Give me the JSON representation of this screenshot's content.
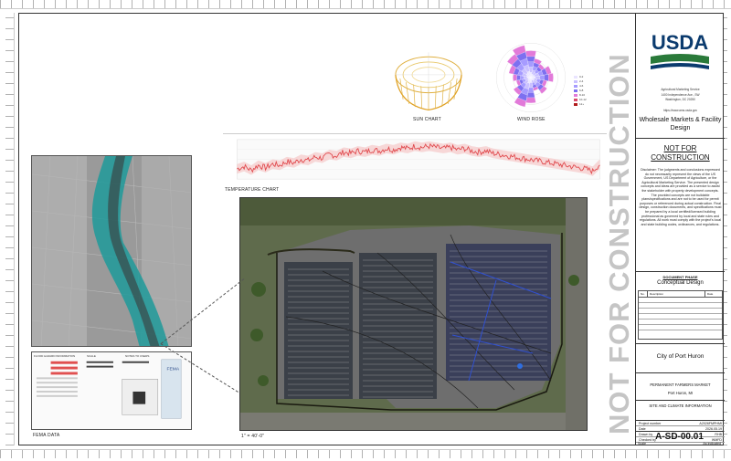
{
  "charts": {
    "sun_chart_label": "SUN CHART",
    "wind_rose_label": "WIND ROSE",
    "temperature_chart_label": "TEMPERATURE CHART",
    "wind_legend": [
      {
        "label": "0-2",
        "color": "#e9e4ff"
      },
      {
        "label": "2-4",
        "color": "#c9c0ff"
      },
      {
        "label": "4-6",
        "color": "#a69bff"
      },
      {
        "label": "6-8",
        "color": "#7d70f0"
      },
      {
        "label": "8-10",
        "color": "#e27ad9"
      },
      {
        "label": "10-12",
        "color": "#d94a6a"
      },
      {
        "label": "12+",
        "color": "#b01a1a"
      }
    ]
  },
  "chart_data": [
    {
      "type": "line",
      "title": "TEMPERATURE CHART",
      "series": [
        {
          "values": [
            12,
            14,
            11,
            15,
            13,
            16,
            15,
            18,
            17,
            20,
            19,
            22,
            21,
            24,
            23,
            26,
            25,
            27,
            26,
            28,
            27,
            29,
            28,
            30,
            29,
            31,
            30,
            31,
            30,
            29,
            30,
            28,
            29,
            27,
            26,
            27,
            25,
            24,
            23,
            22,
            21,
            20,
            19,
            18,
            17,
            16,
            15,
            14,
            13,
            12,
            10,
            16
          ]
        }
      ],
      "colors": {
        "line": "#e0484c",
        "band": "#f3b3b3"
      }
    }
  ],
  "map": {
    "fema_label": "FEMA DATA",
    "legend_headers": [
      "FLOOD HAZARD INFORMATION",
      "SCALE",
      "NOTES TO USERS"
    ],
    "scale_note": "1\" = 40'-0\""
  },
  "title_block": {
    "agency": "Agricultural Marketing Service",
    "address1": "1400 Independence Ave., SW",
    "address2": "Washington, DC 20250",
    "url": "https://www.ams.usda.gov",
    "department": "Wholesale Markets & Facility Design",
    "nfc_heading": "NOT FOR CONSTRUCTION",
    "disclaimer": "Disclaimer: The judgments and conclusions expressed do not necessarily represent the views of the US Government, US Department of Agriculture, or the Agricultural Marketing Service. The presented design concepts and ideas are provided as a service to assist the stakeholder with property development concepts. The provided concepts are not buildable plans/specifications and are not to be used for permit purposes or referenced during actual construction. Final design, construction documents, and specifications must be prepared by a local certified/licensed building professional as governed by local and state rules and regulations. All work must comply with the project's local and state building codes, ordinances, and regulations.",
    "phase_label": "DOCUMENT PHASE",
    "phase": "Conceptual Design",
    "rev_headers": [
      "No.",
      "Description",
      "Date"
    ],
    "client": "City of Port Huron",
    "project_name": "PERMANENT FARMERS MARKET",
    "location": "Port Huron, MI",
    "sheet_title": "SITE AND CLIMATE INFORMATION",
    "info": [
      {
        "label": "Project number",
        "value": "A2026FMPHMI"
      },
      {
        "label": "Date",
        "value": "2026.05.19"
      },
      {
        "label": "Drawn by",
        "value": "RHB"
      },
      {
        "label": "Checked by",
        "value": "WMFD"
      }
    ],
    "sheet_number": "A-SD-00.01",
    "scale_label": "Scale",
    "scale_value": "As indicated"
  },
  "watermark": "NOT FOR CONSTRUCTION"
}
